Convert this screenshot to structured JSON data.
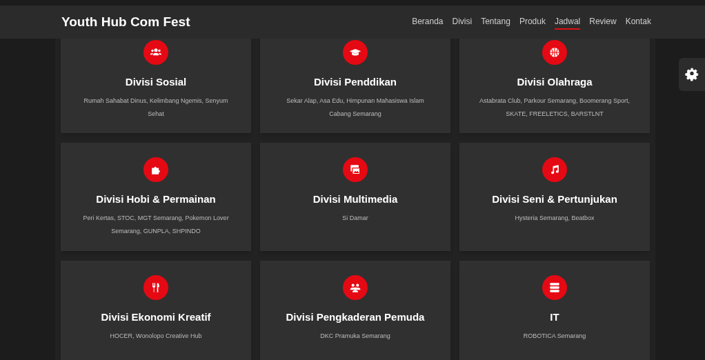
{
  "navbar": {
    "brand": "Youth Hub Com Fest",
    "links": [
      {
        "label": "Beranda",
        "selected": false
      },
      {
        "label": "Divisi",
        "selected": false
      },
      {
        "label": "Tentang",
        "selected": false
      },
      {
        "label": "Produk",
        "selected": false
      },
      {
        "label": "Jadwal",
        "selected": true
      },
      {
        "label": "Review",
        "selected": false
      },
      {
        "label": "Kontak",
        "selected": false
      }
    ]
  },
  "divisions": [
    {
      "title": "Divisi Sosial",
      "description": "Rumah Sahabat Dinus, Kelimbang Ngemis, Senyum Sehat"
    },
    {
      "title": "Divisi Penddikan",
      "description": "Sekar Alap, Asa Edu, Himpunan Mahasiswa Islam Cabang Semarang"
    },
    {
      "title": "Divisi Olahraga",
      "description": "Astabrata Club, Parkour Semarang, Boomerang Sport, SKATE, FREELETICS, BARSTLNT"
    },
    {
      "title": "Divisi Hobi & Permainan",
      "description": "Peri Kertas, STOC, MGT Semarang, Pokemon Lover Semarang, GUNPLA, SHPINDO"
    },
    {
      "title": "Divisi Multimedia",
      "description": "Si Damar"
    },
    {
      "title": "Divisi Seni & Pertunjukan",
      "description": "Hysteria Semarang, Beatbox"
    },
    {
      "title": "Divisi Ekonomi Kreatif",
      "description": "HOCER, Wonolopo Creative Hub"
    },
    {
      "title": "Divisi Pengkaderan Pemuda",
      "description": "DKC Pramuka Semarang"
    },
    {
      "title": "IT",
      "description": "ROBOTICA Semarang"
    }
  ]
}
